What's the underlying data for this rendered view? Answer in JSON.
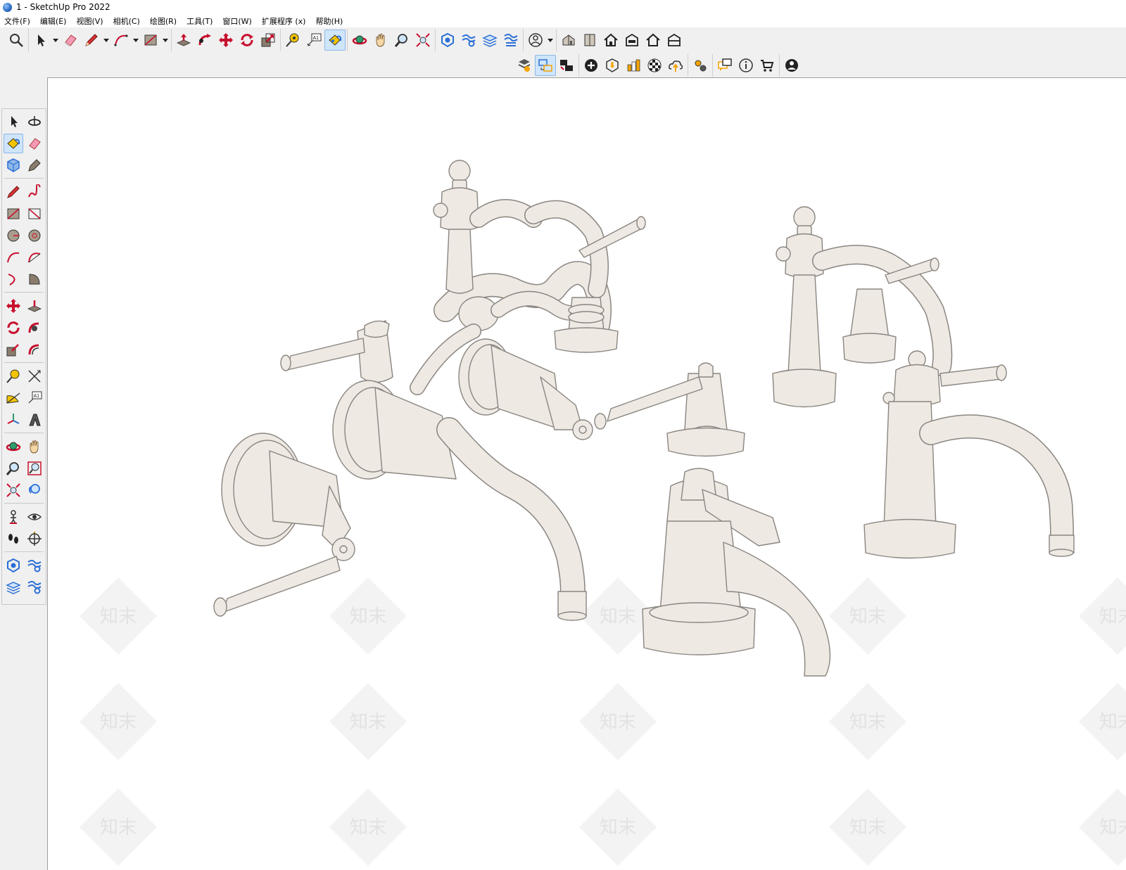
{
  "window": {
    "title": "1 - SketchUp Pro 2022"
  },
  "menu": {
    "items": [
      {
        "label": "文件(F)"
      },
      {
        "label": "编辑(E)"
      },
      {
        "label": "视图(V)"
      },
      {
        "label": "相机(C)"
      },
      {
        "label": "绘图(R)"
      },
      {
        "label": "工具(T)"
      },
      {
        "label": "窗口(W)"
      },
      {
        "label": "扩展程序 (x)"
      },
      {
        "label": "帮助(H)"
      }
    ]
  },
  "toolbar": {
    "text_tool_label": "A1",
    "active_tool": "paint-bucket",
    "colors": {
      "accent_red": "#c8102e",
      "active_bg": "#cfe5fb",
      "icon_dark": "#333333"
    }
  },
  "left_toolbar": {
    "text_tool_label": "A1"
  },
  "viewport": {
    "watermark_text": "知末",
    "model_color": "#efe9e3",
    "model_edge_color": "#8a8580",
    "background_color": "#ffffff"
  }
}
